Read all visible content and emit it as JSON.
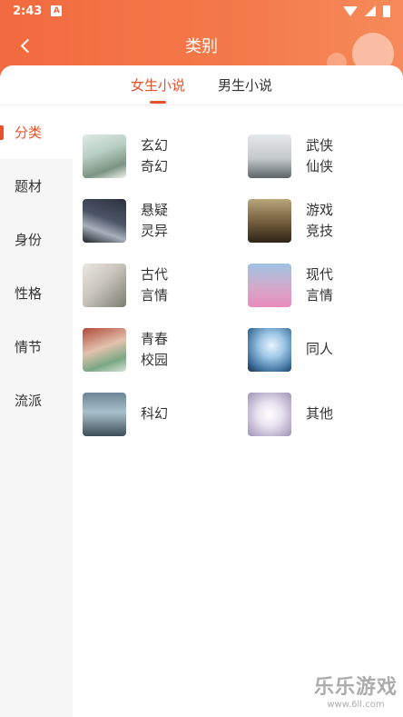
{
  "status_bar": {
    "time": "2:43",
    "notification_icon": "A"
  },
  "header": {
    "title": "类别",
    "back_icon": "chevron-left-icon",
    "accent_color": "#f26a3f"
  },
  "tabs": [
    {
      "label": "女生小说",
      "active": true
    },
    {
      "label": "男生小说",
      "active": false
    }
  ],
  "sidebar": {
    "items": [
      {
        "label": "分类",
        "active": true
      },
      {
        "label": "题材",
        "active": false
      },
      {
        "label": "身份",
        "active": false
      },
      {
        "label": "性格",
        "active": false
      },
      {
        "label": "情节",
        "active": false
      },
      {
        "label": "流派",
        "active": false
      }
    ]
  },
  "categories": [
    {
      "label": "玄幻奇幻",
      "thumb": "t1"
    },
    {
      "label": "武侠仙侠",
      "thumb": "t2"
    },
    {
      "label": "悬疑灵异",
      "thumb": "t3"
    },
    {
      "label": "游戏竞技",
      "thumb": "t4"
    },
    {
      "label": "古代言情",
      "thumb": "t5"
    },
    {
      "label": "现代言情",
      "thumb": "t6"
    },
    {
      "label": "青春校园",
      "thumb": "t7"
    },
    {
      "label": "同人",
      "thumb": "t8"
    },
    {
      "label": "科幻",
      "thumb": "t9"
    },
    {
      "label": "其他",
      "thumb": "t10"
    }
  ],
  "watermark": {
    "main": "乐乐游戏",
    "sub": "www.6ll.com"
  }
}
